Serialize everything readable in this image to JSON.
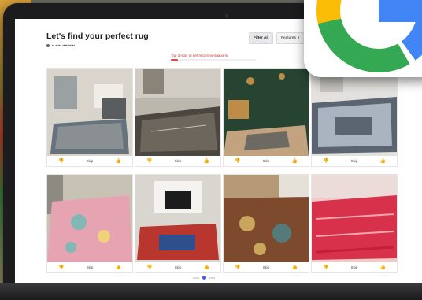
{
  "page": {
    "title": "Let's find your perfect rug",
    "subtitle": "•• • ••• ••••••••••",
    "tip": "Tap 3 rugs to get recommendations",
    "progress_percent": 8
  },
  "controls": {
    "filter_label": "Filter All",
    "features_label": "Features ∨"
  },
  "cards": [
    {
      "vote_label": "Skip",
      "palette": [
        "#d9d5cc",
        "#66737c",
        "#8a8f92"
      ]
    },
    {
      "vote_label": "Skip",
      "palette": [
        "#bcb7ad",
        "#4b4640",
        "#c8c1b5"
      ]
    },
    {
      "vote_label": "Skip",
      "palette": [
        "#274433",
        "#bd8c46",
        "#c2a27f"
      ]
    },
    {
      "vote_label": "Skip",
      "palette": [
        "#e3e1de",
        "#5b6471",
        "#aab4c0"
      ]
    },
    {
      "vote_label": "Skip",
      "palette": [
        "#c8c2b4",
        "#e6a4b3",
        "#82b7b3"
      ]
    },
    {
      "vote_label": "Skip",
      "palette": [
        "#d9d6d0",
        "#b8362e",
        "#2f4f8c"
      ]
    },
    {
      "vote_label": "Skip",
      "palette": [
        "#b59a75",
        "#7d4a2e",
        "#c9a55d"
      ]
    },
    {
      "vote_label": "Skip",
      "palette": [
        "#f1c9c6",
        "#d8314b",
        "#c41f3a"
      ]
    }
  ],
  "pager": {
    "left": "••••••",
    "right": "••••••"
  },
  "colors": {
    "accent": "#3f5bd9",
    "google_blue": "#4285f4",
    "google_red": "#ea4335",
    "google_yellow": "#fbbc05",
    "google_green": "#34a853"
  }
}
